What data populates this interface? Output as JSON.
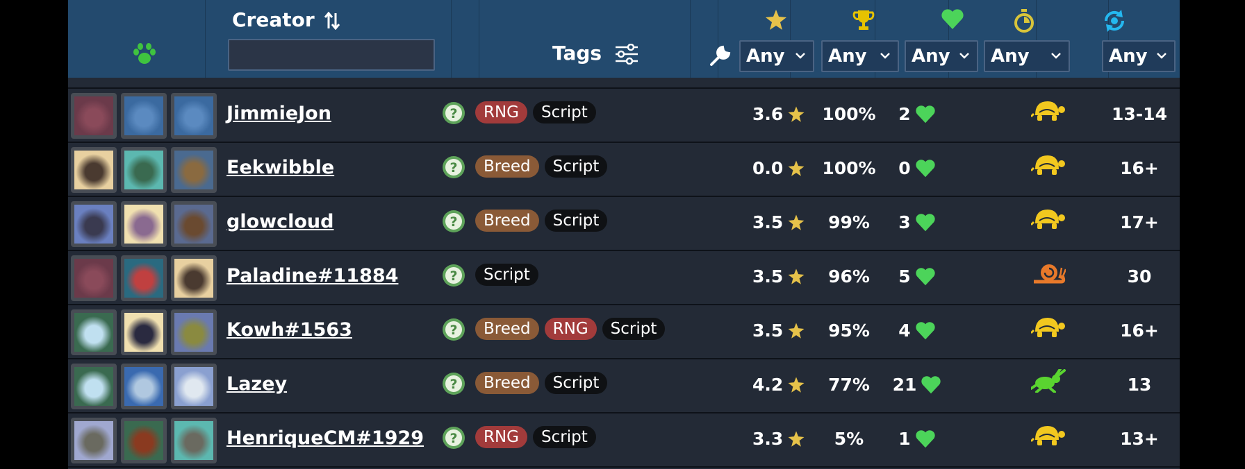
{
  "header": {
    "creator_label": "Creator",
    "creator_input_value": "",
    "tags_label": "Tags",
    "filters": [
      "Any",
      "Any",
      "Any",
      "Any",
      "Any"
    ]
  },
  "colors": {
    "header_bg": "#234a6e",
    "row_bg": "#232a36",
    "star": "#e6c24a",
    "trophy": "#e6c200",
    "heart": "#4cd45a",
    "paw": "#3fc33f",
    "turtle": "#f2c81f",
    "snail": "#e8792a",
    "rabbit": "#5ad430",
    "cycle": "#24b8f0"
  },
  "rows": [
    {
      "creator": "JimmieJon",
      "tags": [
        "RNG",
        "Script"
      ],
      "rating": "3.6",
      "win": "100%",
      "likes": "2",
      "speed": "turtle-icon",
      "level": "13-14",
      "pets": [
        [
          "#6b3a4a",
          "#8a4a5a"
        ],
        [
          "#3b6aa0",
          "#5b8ac0"
        ],
        [
          "#3b6aa0",
          "#5b8ac0"
        ]
      ]
    },
    {
      "creator": "Eekwibble",
      "tags": [
        "Breed",
        "Script"
      ],
      "rating": "0.0",
      "win": "100%",
      "likes": "0",
      "speed": "turtle-icon",
      "level": "16+",
      "pets": [
        [
          "#e8d0a0",
          "#4a3a30"
        ],
        [
          "#5cb8b0",
          "#3a6a50"
        ],
        [
          "#4a6a90",
          "#8a6a40"
        ]
      ]
    },
    {
      "creator": "glowcloud",
      "tags": [
        "Breed",
        "Script"
      ],
      "rating": "3.5",
      "win": "99%",
      "likes": "3",
      "speed": "turtle-icon",
      "level": "17+",
      "pets": [
        [
          "#6a80c0",
          "#3a3a50"
        ],
        [
          "#f0e0b0",
          "#8a6a90"
        ],
        [
          "#5a6a90",
          "#6a4a30"
        ]
      ]
    },
    {
      "creator": "Paladine#11884",
      "tags": [
        "Script"
      ],
      "rating": "3.5",
      "win": "96%",
      "likes": "5",
      "speed": "snail-icon",
      "level": "30",
      "pets": [
        [
          "#6b3a4a",
          "#8a4a5a"
        ],
        [
          "#2a6a80",
          "#c04040"
        ],
        [
          "#e8d0a0",
          "#4a3a30"
        ]
      ]
    },
    {
      "creator": "Kowh#1563",
      "tags": [
        "Breed",
        "RNG",
        "Script"
      ],
      "rating": "3.5",
      "win": "95%",
      "likes": "4",
      "speed": "turtle-icon",
      "level": "16+",
      "pets": [
        [
          "#3a6a50",
          "#c0e0f0"
        ],
        [
          "#f0e0b0",
          "#2a2a40"
        ],
        [
          "#6a7ab0",
          "#8a8a40"
        ]
      ]
    },
    {
      "creator": "Lazey",
      "tags": [
        "Breed",
        "Script"
      ],
      "rating": "4.2",
      "win": "77%",
      "likes": "21",
      "speed": "rabbit-icon",
      "level": "13",
      "pets": [
        [
          "#3a6a50",
          "#c0e0f0"
        ],
        [
          "#3a6ab0",
          "#b0c8e0"
        ],
        [
          "#8aa0d0",
          "#e0e8f0"
        ]
      ]
    },
    {
      "creator": "HenriqueCM#1929",
      "tags": [
        "RNG",
        "Script"
      ],
      "rating": "3.3",
      "win": "5%",
      "likes": "1",
      "speed": "turtle-icon",
      "level": "13+",
      "pets": [
        [
          "#a0a8d0",
          "#6a6a60"
        ],
        [
          "#3a6a50",
          "#8a3a20"
        ],
        [
          "#5cb8b0",
          "#6a6a60"
        ]
      ]
    }
  ]
}
